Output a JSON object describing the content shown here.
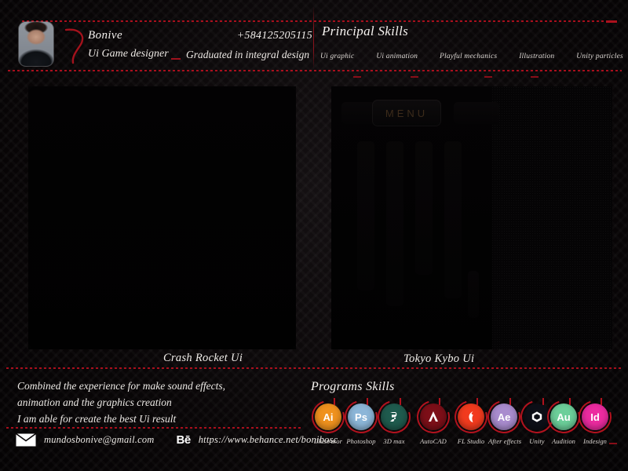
{
  "profile": {
    "name": "Bonive",
    "role": "Ui Game designer",
    "graduation": "Graduated in integral design",
    "phone": "+584125205115",
    "avatar_icon": "portrait-photo"
  },
  "principal_skills": {
    "title": "Principal Skills",
    "items": [
      {
        "label": "Ui graphic"
      },
      {
        "label": "Ui animation"
      },
      {
        "label": "Playful mechanics"
      },
      {
        "label": "Illustration"
      },
      {
        "label": "Unity particles"
      }
    ]
  },
  "projects": [
    {
      "caption": "Crash Rocket Ui",
      "menu_label": ""
    },
    {
      "caption": "Tokyo Kybo Ui",
      "menu_label": "MENU"
    }
  ],
  "about": {
    "line1": "Combined the experience for make sound effects,",
    "line2": "animation and the graphics creation",
    "line3": "I am able for create the best Ui result"
  },
  "programs_skills": {
    "title": "Programs Skills",
    "items": [
      {
        "label": "Illustrator",
        "mark": "Ai",
        "color": "#f0921e",
        "text_color": "#ffffff",
        "glyph": "text"
      },
      {
        "label": "Photoshop",
        "mark": "Ps",
        "color": "#8cb6d8",
        "text_color": "#ffffff",
        "glyph": "text"
      },
      {
        "label": "3D max",
        "mark": "",
        "color": "#1f5b4e",
        "text_color": "#ffffff",
        "glyph": "max"
      },
      {
        "label": "AutoCAD",
        "mark": "",
        "color": "#7d0f18",
        "text_color": "#ffffff",
        "glyph": "autocad"
      },
      {
        "label": "FL Studio",
        "mark": "",
        "color": "#f23b1e",
        "text_color": "#ffffff",
        "glyph": "flstudio"
      },
      {
        "label": "After effects",
        "mark": "Ae",
        "color": "#a98cce",
        "text_color": "#ffffff",
        "glyph": "text"
      },
      {
        "label": "Unity",
        "mark": "",
        "color": "#0d0f17",
        "text_color": "#ffffff",
        "glyph": "unity"
      },
      {
        "label": "Audition",
        "mark": "Au",
        "color": "#6ccf9a",
        "text_color": "#ffffff",
        "glyph": "text"
      },
      {
        "label": "Indesign",
        "mark": "Id",
        "color": "#ec2ba0",
        "text_color": "#ffffff",
        "glyph": "text"
      }
    ]
  },
  "contact": {
    "email": "mundosbonive@gmail.com",
    "behance_mark": "Bē",
    "behance_url": "https://www.behance.net/bonibosc",
    "mail_icon": "envelope-icon"
  },
  "theme": {
    "accent_red": "#b2121e",
    "background": "#0a0708",
    "text": "#ece9e5"
  }
}
